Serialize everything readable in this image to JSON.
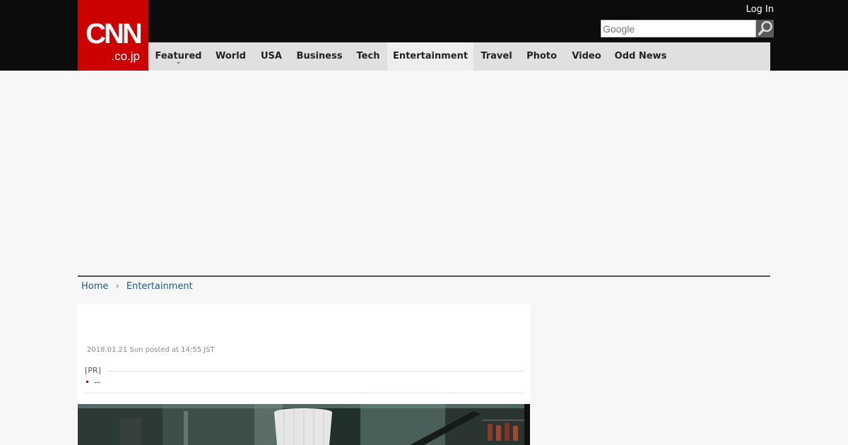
{
  "header": {
    "logo_main": "CNN",
    "logo_sub": ".co.jp",
    "login_label": "Log In",
    "search_placeholder": "Google"
  },
  "nav": {
    "items": [
      {
        "label": "Featured",
        "caret": "⌄"
      },
      {
        "label": "World"
      },
      {
        "label": "USA"
      },
      {
        "label": "Business"
      },
      {
        "label": "Tech"
      },
      {
        "label": "Entertainment",
        "active": true
      },
      {
        "label": "Travel"
      },
      {
        "label": "Photo"
      },
      {
        "label": "Video"
      },
      {
        "label": "Odd News"
      }
    ]
  },
  "breadcrumb": {
    "home": "Home",
    "separator": "›",
    "current": "Entertainment"
  },
  "article": {
    "posted": "2018.01.21 Sun posted at 14:55 JST",
    "pr_label": "[PR]",
    "pr_item": "--"
  },
  "colors": {
    "brand_red": "#cc0000",
    "header_bg": "#0c0c0c",
    "nav_bg": "#e0e0e0",
    "link_blue": "#1a5a96"
  },
  "icons": {
    "search": "magnifier-icon"
  }
}
